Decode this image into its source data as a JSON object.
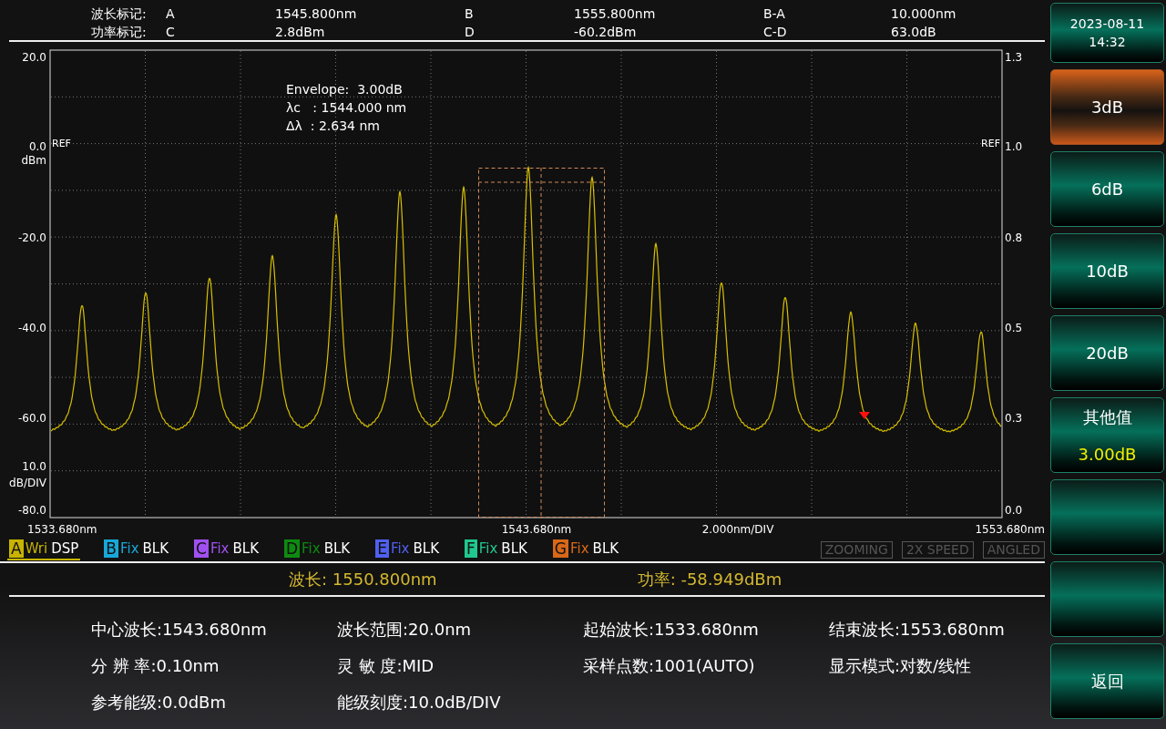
{
  "markers": [
    {
      "label": "波长标记:",
      "items": [
        {
          "name": "A",
          "value": "1545.800nm"
        },
        {
          "name": "B",
          "value": "1555.800nm"
        },
        {
          "name": "B-A",
          "value": "10.000nm"
        }
      ]
    },
    {
      "label": "功率标记:",
      "items": [
        {
          "name": "C",
          "value": "2.8dBm"
        },
        {
          "name": "D",
          "value": "-60.2dBm"
        },
        {
          "name": "C-D",
          "value": "63.0dB"
        }
      ]
    }
  ],
  "chart": {
    "left_labels": [
      "20.0",
      "0.0",
      "dBm",
      "-20.0",
      "-40.0",
      "-60.0",
      "10.0",
      "dB/DIV",
      "-80.0"
    ],
    "right_labels": [
      "1.3",
      "1.0",
      "0.8",
      "0.5",
      "0.3",
      "0.0"
    ],
    "ref_labels": [
      "REF",
      "REF"
    ],
    "x_labels": [
      "1533.680nm",
      "1543.680nm",
      "2.000nm/DIV",
      "1553.680nm"
    ],
    "annotation": [
      "Envelope:  3.00dB",
      "λc   : 1544.000 nm",
      "Δλ  : 2.634 nm"
    ]
  },
  "traces": [
    {
      "letter": "A",
      "mode": "Wri",
      "display": "DSP",
      "color": "#c8b400",
      "selected": true
    },
    {
      "letter": "B",
      "mode": "Fix",
      "display": "BLK",
      "color": "#18a8d8",
      "selected": false
    },
    {
      "letter": "C",
      "mode": "Fix",
      "display": "BLK",
      "color": "#a050f0",
      "selected": false
    },
    {
      "letter": "D",
      "mode": "Fix",
      "display": "BLK",
      "color": "#0e8a10",
      "selected": false
    },
    {
      "letter": "E",
      "mode": "Fix",
      "display": "BLK",
      "color": "#5060f0",
      "selected": false
    },
    {
      "letter": "F",
      "mode": "Fix",
      "display": "BLK",
      "color": "#20c890",
      "selected": false
    },
    {
      "letter": "G",
      "mode": "Fix",
      "display": "BLK",
      "color": "#d86818",
      "selected": false
    }
  ],
  "status_flags": [
    {
      "label": "ZOOMING",
      "on": false
    },
    {
      "label": "2X SPEED",
      "on": false
    },
    {
      "label": "ANGLED",
      "on": false
    }
  ],
  "readout": [
    "波长: 1550.800nm",
    "功率: -58.949dBm"
  ],
  "params": [
    [
      "中心波长:1543.680nm",
      "波长范围:20.0nm",
      "起始波长:1533.680nm",
      "结束波长:1553.680nm"
    ],
    [
      "分 辨 率:0.10nm",
      "灵 敏 度:MID",
      "采样点数:1001(AUTO)",
      "显示模式:对数/线性"
    ],
    [
      "参考能级:0.0dBm",
      "能级刻度:10.0dB/DIV"
    ]
  ],
  "clock": {
    "date": "2023-08-11",
    "time": "14:32"
  },
  "softkeys": [
    {
      "label": "3dB",
      "selected": true
    },
    {
      "label": "6dB",
      "selected": false
    },
    {
      "label": "10dB",
      "selected": false
    },
    {
      "label": "20dB",
      "selected": false
    },
    {
      "label": "其他值",
      "value": "3.00dB",
      "selected": false
    },
    {
      "selected": false
    },
    {
      "selected": false
    },
    {
      "label": "返回",
      "selected": false
    }
  ]
}
